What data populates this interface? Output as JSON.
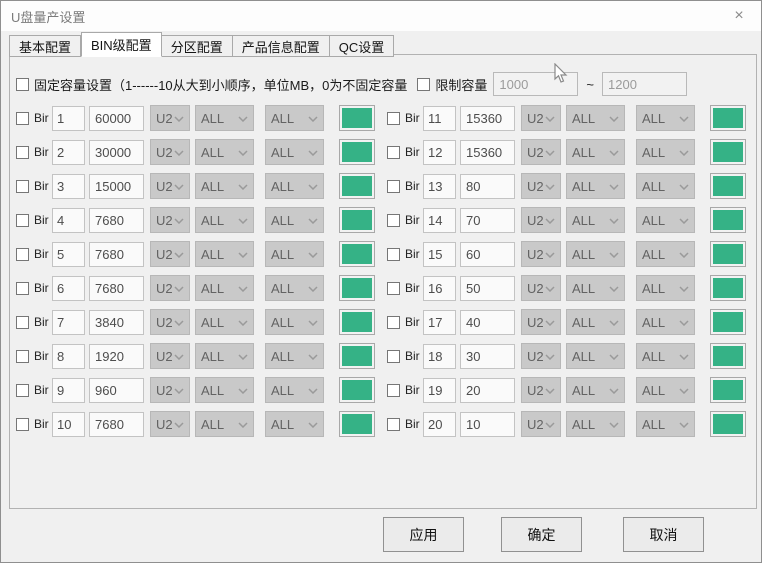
{
  "window": {
    "title": "U盘量产设置",
    "close_glyph": "×"
  },
  "tabs": [
    {
      "label": "基本配置"
    },
    {
      "label": "BIN级配置"
    },
    {
      "label": "分区配置"
    },
    {
      "label": "产品信息配置"
    },
    {
      "label": "QC设置"
    }
  ],
  "options": {
    "fixed_capacity_label": "固定容量设置（1------10从大到小顺序，单位MB，0为不固定容量",
    "limit_capacity_label": "限制容量",
    "limit_min": "1000",
    "limit_separator": "~",
    "limit_max": "1200"
  },
  "bins": {
    "row_label": "Bir",
    "combo_interface": "U2",
    "combo_all_1": "ALL",
    "combo_all_2": "ALL",
    "swatch_color": "#35b286",
    "left": [
      {
        "index": "1",
        "value": "60000"
      },
      {
        "index": "2",
        "value": "30000"
      },
      {
        "index": "3",
        "value": "15000"
      },
      {
        "index": "4",
        "value": "7680"
      },
      {
        "index": "5",
        "value": "7680"
      },
      {
        "index": "6",
        "value": "7680"
      },
      {
        "index": "7",
        "value": "3840"
      },
      {
        "index": "8",
        "value": "1920"
      },
      {
        "index": "9",
        "value": "960"
      },
      {
        "index": "10",
        "value": "7680"
      }
    ],
    "right": [
      {
        "index": "11",
        "value": "15360"
      },
      {
        "index": "12",
        "value": "15360"
      },
      {
        "index": "13",
        "value": "80"
      },
      {
        "index": "14",
        "value": "70"
      },
      {
        "index": "15",
        "value": "60"
      },
      {
        "index": "16",
        "value": "50"
      },
      {
        "index": "17",
        "value": "40"
      },
      {
        "index": "18",
        "value": "30"
      },
      {
        "index": "19",
        "value": "20"
      },
      {
        "index": "20",
        "value": "10"
      }
    ]
  },
  "buttons": {
    "apply": "应用",
    "ok": "确定",
    "cancel": "取消"
  }
}
